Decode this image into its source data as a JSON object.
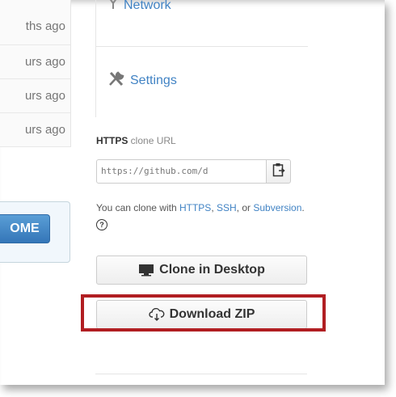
{
  "left_list": {
    "times": [
      "ths ago",
      "urs ago",
      "urs ago",
      "urs ago"
    ],
    "welcome_button": "OME"
  },
  "sidebar": {
    "network_label": "Network",
    "settings_label": "Settings"
  },
  "clone": {
    "title_bold": "HTTPS",
    "title_rest": " clone URL",
    "url_value": "https://github.com/d",
    "help_prefix": "You can clone with ",
    "help_https": "HTTPS",
    "help_comma": ", ",
    "help_ssh": "SSH",
    "help_middle": ", or ",
    "help_svn": "Subversion",
    "help_suffix": ".",
    "help_icon": "?"
  },
  "buttons": {
    "clone_desktop": "Clone in Desktop",
    "download_zip": "Download ZIP"
  },
  "colors": {
    "link": "#4183c4",
    "highlight": "#b11e22",
    "primary_button": "#3476b8"
  }
}
